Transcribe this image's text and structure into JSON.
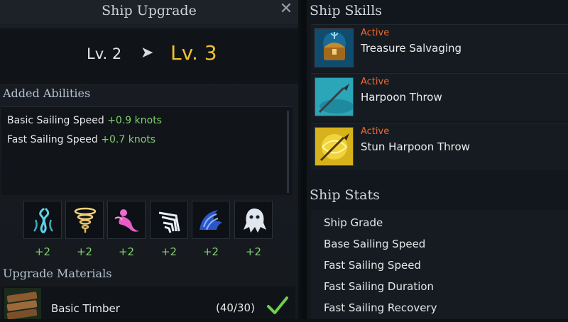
{
  "upgrade": {
    "title": "Ship Upgrade",
    "close_glyph": "✕",
    "level_from": "Lv. 2",
    "level_arrow": "➤",
    "level_to": "Lv. 3",
    "added_abilities_heading": "Added Abilities",
    "abilities": [
      {
        "name": "Basic Sailing Speed",
        "value": "+0.9 knots"
      },
      {
        "name": "Fast Sailing Speed",
        "value": "+0.7 knots"
      }
    ],
    "crew_icons": [
      {
        "icon": "seaweed-icon",
        "bonus": "+2"
      },
      {
        "icon": "tornado-icon",
        "bonus": "+2"
      },
      {
        "icon": "mermaid-icon",
        "bonus": "+2"
      },
      {
        "icon": "claw-icon",
        "bonus": "+2"
      },
      {
        "icon": "wave-icon",
        "bonus": "+2"
      },
      {
        "icon": "ghost-icon",
        "bonus": "+2"
      }
    ],
    "materials_heading": "Upgrade Materials",
    "materials": [
      {
        "name": "Basic Timber",
        "count": "(40/30)",
        "icon": "timber-icon",
        "status_icon": "check-icon"
      }
    ]
  },
  "skills": {
    "heading": "Ship Skills",
    "items": [
      {
        "tag": "Active",
        "name": "Treasure Salvaging",
        "icon": "treasure-chest-icon"
      },
      {
        "tag": "Active",
        "name": "Harpoon Throw",
        "icon": "harpoon-icon"
      },
      {
        "tag": "Active",
        "name": "Stun Harpoon Throw",
        "icon": "stun-harpoon-icon"
      }
    ]
  },
  "stats": {
    "heading": "Ship Stats",
    "items": [
      "Ship Grade",
      "Base Sailing Speed",
      "Fast Sailing Speed",
      "Fast Sailing Duration",
      "Fast Sailing Recovery"
    ]
  },
  "colors": {
    "level_to": "#f1c12d",
    "positive_value": "#7ed06c",
    "active_tag": "#f06a2c"
  }
}
